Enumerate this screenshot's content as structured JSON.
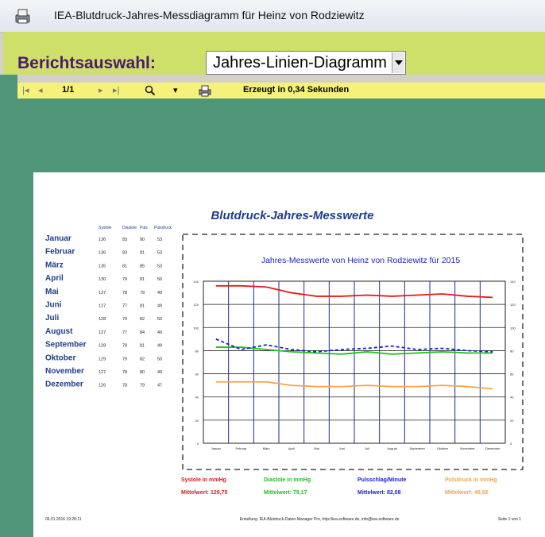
{
  "window": {
    "title": "IEA-Blutdruck-Jahres-Messdiagramm für Heinz von Rodziewitz"
  },
  "report_selection": {
    "label": "Berichtsauswahl:",
    "selected": "Jahres-Linien-Diagramm"
  },
  "toolbar": {
    "first_icon": "|◂",
    "prev_icon": "◂",
    "page_indicator": "1/1",
    "next_icon": "▸",
    "last_icon": "▸|",
    "zoom_icon": "magnifier-icon",
    "zoom_dropdown_icon": "▾",
    "print_icon": "printer-icon",
    "status": "Erzeugt in 0,34 Sekunden"
  },
  "report": {
    "title": "Blutdruck-Jahres-Messwerte",
    "table_headers": [
      "Systole",
      "Diastole",
      "Puls",
      "Pulsdruck"
    ],
    "months": [
      {
        "name": "Januar",
        "systole": "136",
        "diastole": "83",
        "puls": "90",
        "pulsdruck": "53"
      },
      {
        "name": "Februar",
        "systole": "136",
        "diastole": "83",
        "puls": "81",
        "pulsdruck": "53"
      },
      {
        "name": "März",
        "systole": "135",
        "diastole": "81",
        "puls": "85",
        "pulsdruck": "53"
      },
      {
        "name": "April",
        "systole": "130",
        "diastole": "79",
        "puls": "81",
        "pulsdruck": "50"
      },
      {
        "name": "Mai",
        "systole": "127",
        "diastole": "78",
        "puls": "79",
        "pulsdruck": "49"
      },
      {
        "name": "Juni",
        "systole": "127",
        "diastole": "77",
        "puls": "81",
        "pulsdruck": "49"
      },
      {
        "name": "Juli",
        "systole": "128",
        "diastole": "79",
        "puls": "82",
        "pulsdruck": "50"
      },
      {
        "name": "August",
        "systole": "127",
        "diastole": "77",
        "puls": "84",
        "pulsdruck": "49"
      },
      {
        "name": "September",
        "systole": "128",
        "diastole": "78",
        "puls": "81",
        "pulsdruck": "49"
      },
      {
        "name": "Oktober",
        "systole": "129",
        "diastole": "79",
        "puls": "82",
        "pulsdruck": "50"
      },
      {
        "name": "November",
        "systole": "127",
        "diastole": "78",
        "puls": "80",
        "pulsdruck": "49"
      },
      {
        "name": "Dezember",
        "systole": "126",
        "diastole": "78",
        "puls": "79",
        "pulsdruck": "47"
      }
    ],
    "legend": [
      {
        "label": "Systole in mmHg",
        "mean": "Mittelwert: 129,75",
        "color": "#e8191b"
      },
      {
        "label": "Diastole in mmHg",
        "mean": "Mittelwert: 79,17",
        "color": "#22c11e"
      },
      {
        "label": "Pulsschlag/Minute",
        "mean": "Mittelwert: 82,08",
        "color": "#1a22d4"
      },
      {
        "label": "Pulsdruck in mmHg",
        "mean": "Mittelwert: 49,92",
        "color": "#f5a44a"
      }
    ],
    "footer_left": "06.01.2016 19:28:11",
    "footer_center": "Erstellung: IEA-Blutdruck-Daten-Manager Pro, http://iea-software.de, info@iea-software.de",
    "footer_right": "Seite 1 von 1"
  },
  "chart_data": {
    "type": "line",
    "title": "Jahres-Messwerte von Heinz von Rodziewitz für 2015",
    "categories": [
      "Januar",
      "Februar",
      "März",
      "April",
      "Mai",
      "Juni",
      "Juli",
      "August",
      "September",
      "Oktober",
      "November",
      "Dezember"
    ],
    "ylim": [
      0,
      140
    ],
    "yticks": [
      0,
      20,
      40,
      60,
      80,
      100,
      120,
      140
    ],
    "series": [
      {
        "name": "Systole in mmHg",
        "color": "#e8191b",
        "dash": false,
        "values": [
          136,
          136,
          135,
          130,
          127,
          127,
          128,
          127,
          128,
          129,
          127,
          126
        ]
      },
      {
        "name": "Diastole in mmHg",
        "color": "#22c11e",
        "dash": false,
        "values": [
          83,
          83,
          81,
          79,
          78,
          77,
          79,
          77,
          78,
          79,
          78,
          78
        ]
      },
      {
        "name": "Pulsschlag/Minute",
        "color": "#1a22d4",
        "dash": true,
        "values": [
          90,
          81,
          85,
          81,
          79,
          81,
          82,
          84,
          81,
          82,
          80,
          79
        ]
      },
      {
        "name": "Pulsdruck in mmHg",
        "color": "#f5a44a",
        "dash": false,
        "values": [
          53,
          53,
          53,
          50,
          49,
          49,
          50,
          49,
          49,
          50,
          49,
          47
        ]
      }
    ],
    "grid": true
  }
}
